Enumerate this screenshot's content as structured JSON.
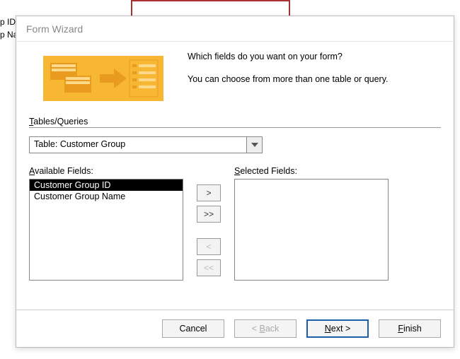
{
  "background": {
    "left_items": [
      "p ID",
      "p Na"
    ]
  },
  "dialog": {
    "title": "Form Wizard",
    "intro1": "Which fields do you want on your form?",
    "intro2": "You can choose from more than one table or query.",
    "tables_queries_label": "Tables/Queries",
    "combo_value": "Table: Customer Group",
    "available_label": "Available Fields:",
    "selected_label": "Selected Fields:",
    "available_fields": [
      "Customer Group ID",
      "Customer Group Name"
    ],
    "selected_fields": [],
    "buttons": {
      "add": ">",
      "add_all": ">>",
      "remove": "<",
      "remove_all": "<<",
      "cancel": "Cancel",
      "back_pre": "< ",
      "back_label": "Back",
      "next_label": "Next",
      "next_post": " >",
      "finish_label": "Finish"
    }
  }
}
